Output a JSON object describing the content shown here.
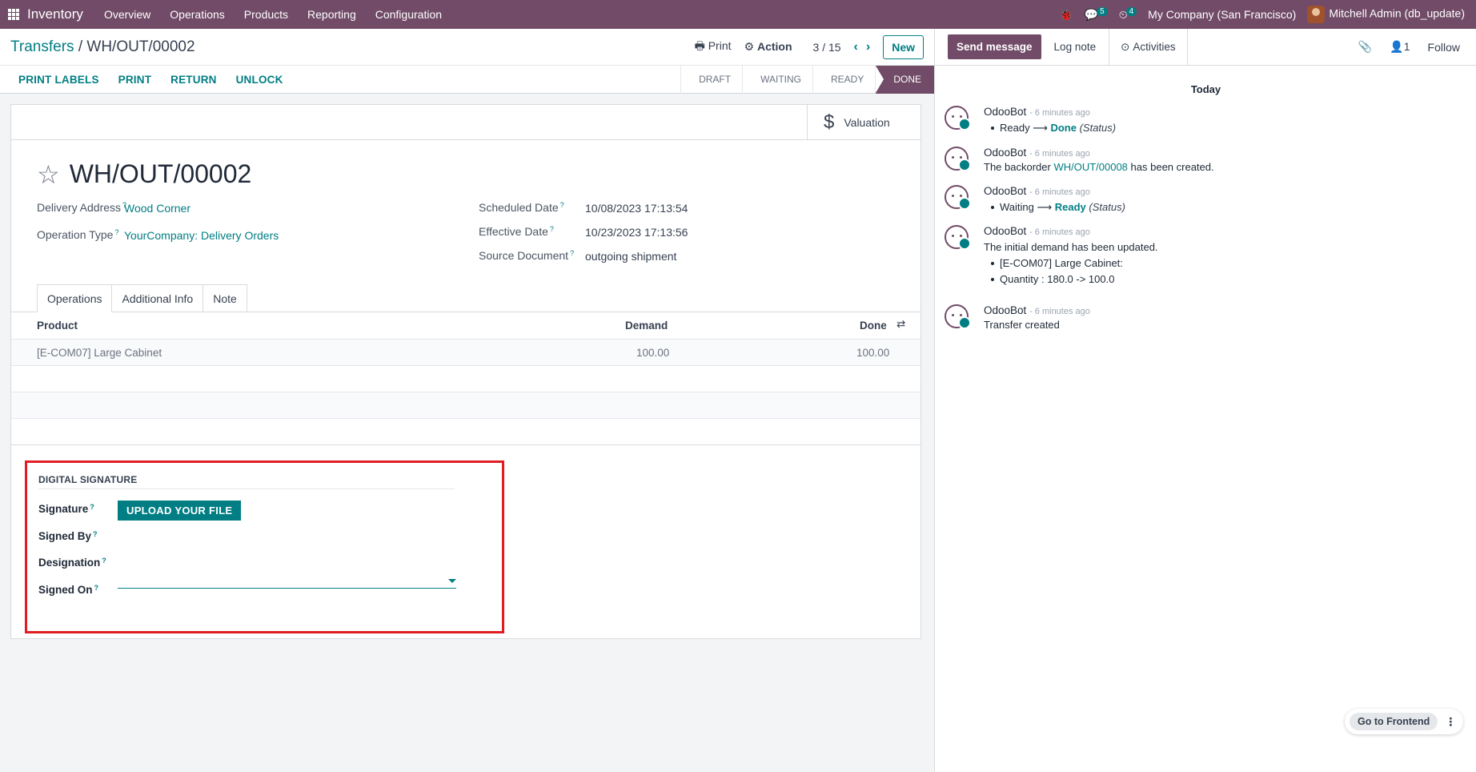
{
  "topbar": {
    "app_name": "Inventory",
    "menu": [
      "Overview",
      "Operations",
      "Products",
      "Reporting",
      "Configuration"
    ],
    "messages_count": "5",
    "activities_count": "4",
    "company": "My Company (San Francisco)",
    "user": "Mitchell Admin (db_update)"
  },
  "control_panel": {
    "breadcrumb_parent": "Transfers",
    "breadcrumb_sep": "/",
    "breadcrumb_current": "WH/OUT/00002",
    "print_label": "Print",
    "action_label": "Action",
    "pager": "3 / 15",
    "new_label": "New"
  },
  "statusbar": {
    "actions": [
      "PRINT LABELS",
      "PRINT",
      "RETURN",
      "UNLOCK"
    ],
    "steps": [
      "DRAFT",
      "WAITING",
      "READY",
      "DONE"
    ],
    "current_step": "DONE"
  },
  "form": {
    "smart_button": "Valuation",
    "title": "WH/OUT/00002",
    "delivery_address_label": "Delivery Address",
    "delivery_address": "Wood Corner",
    "operation_type_label": "Operation Type",
    "operation_type": "YourCompany: Delivery Orders",
    "scheduled_date_label": "Scheduled Date",
    "scheduled_date": "10/08/2023 17:13:54",
    "effective_date_label": "Effective Date",
    "effective_date": "10/23/2023 17:13:56",
    "source_document_label": "Source Document",
    "source_document": "outgoing shipment",
    "tabs": [
      "Operations",
      "Additional Info",
      "Note"
    ],
    "table": {
      "headers": [
        "Product",
        "Demand",
        "Done"
      ],
      "rows": [
        {
          "product": "[E-COM07] Large Cabinet",
          "demand": "100.00",
          "done": "100.00"
        }
      ]
    },
    "signature": {
      "section_title": "DIGITAL SIGNATURE",
      "signature_label": "Signature",
      "upload_label": "UPLOAD YOUR FILE",
      "signed_by_label": "Signed By",
      "designation_label": "Designation",
      "signed_on_label": "Signed On"
    }
  },
  "chatter": {
    "send_message": "Send message",
    "log_note": "Log note",
    "activities": "Activities",
    "followers_count": "1",
    "follow": "Follow",
    "day_label": "Today",
    "messages": [
      {
        "author": "OdooBot",
        "time": "- 6 minutes ago",
        "from": "Ready",
        "to": "Done",
        "field": "(Status)"
      },
      {
        "author": "OdooBot",
        "time": "- 6 minutes ago",
        "text_before": "The backorder ",
        "link": "WH/OUT/00008",
        "text_after": " has been created."
      },
      {
        "author": "OdooBot",
        "time": "- 6 minutes ago",
        "from": "Waiting",
        "to": "Ready",
        "field": "(Status)"
      },
      {
        "author": "OdooBot",
        "time": "- 6 minutes ago",
        "text": "The initial demand has been updated.",
        "items": [
          "[E-COM07] Large Cabinet:"
        ],
        "subitems": [
          "Quantity : 180.0 -> 100.0"
        ]
      },
      {
        "author": "OdooBot",
        "time": "- 6 minutes ago",
        "text": "Transfer created"
      }
    ]
  },
  "floating": {
    "go_frontend": "Go to Frontend"
  },
  "colors": {
    "brand": "#714B67",
    "accent": "#017E84",
    "highlight": "#e11d21"
  }
}
